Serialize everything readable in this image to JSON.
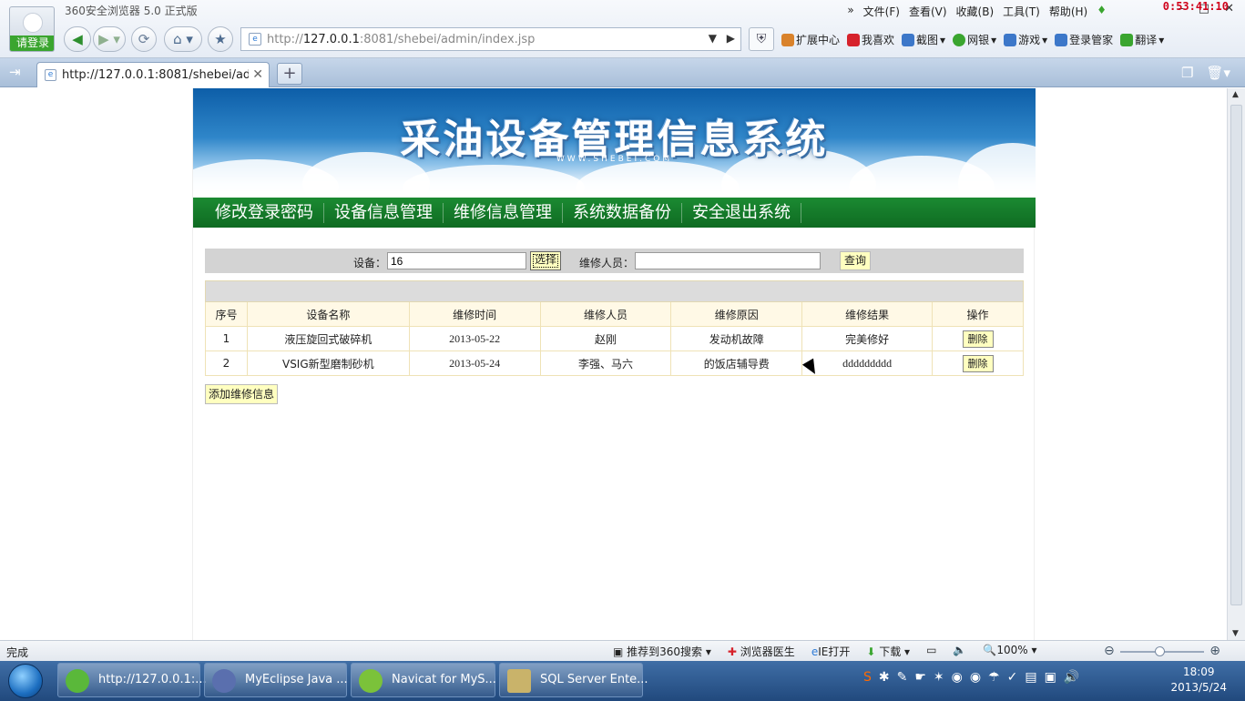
{
  "browser": {
    "title": "360安全浏览器 5.0 正式版",
    "login_label": "请登录",
    "menu": [
      "文件(F)",
      "查看(V)",
      "收藏(B)",
      "工具(T)",
      "帮助(H)"
    ],
    "timer": "0:53:41:10",
    "address": {
      "protocol": "http://",
      "host": "127.0.0.1",
      "path": ":8081/shebei/admin/index.jsp"
    },
    "toolbar_links": [
      {
        "label": "扩展中心",
        "icon": "extension-icon",
        "color": "#d9822b"
      },
      {
        "label": "我喜欢",
        "icon": "heart-icon",
        "color": "#d6222b"
      },
      {
        "label": "截图",
        "icon": "screenshot-icon",
        "color": "#3c77c9"
      },
      {
        "label": "网银",
        "icon": "bank-icon",
        "color": "#3aa52f"
      },
      {
        "label": "游戏",
        "icon": "game-icon",
        "color": "#3c77c9"
      },
      {
        "label": "登录管家",
        "icon": "key-icon",
        "color": "#3c77c9"
      },
      {
        "label": "翻译",
        "icon": "translate-icon",
        "color": "#3aa52f"
      }
    ],
    "tab": {
      "title": "http://127.0.0.1:8081/shebei/admi..."
    }
  },
  "site": {
    "title": "采油设备管理信息系统",
    "subtitle": "WWW.SHEBEI.COM",
    "nav": [
      "修改登录密码",
      "设备信息管理",
      "维修信息管理",
      "系统数据备份",
      "安全退出系统"
    ]
  },
  "search": {
    "device_label": "设备：",
    "device_value": "16",
    "select_label": "选择",
    "repair_person_label": "维修人员：",
    "repair_person_value": "",
    "query_label": "查询"
  },
  "table": {
    "columns": [
      "序号",
      "设备名称",
      "维修时间",
      "维修人员",
      "维修原因",
      "维修结果",
      "操作"
    ],
    "rows": [
      {
        "no": "1",
        "device": "液压旋回式破碎机",
        "time": "2013-05-22",
        "person": "赵刚",
        "reason": "发动机故障",
        "result": "完美修好",
        "action": "删除"
      },
      {
        "no": "2",
        "device": "VSIG新型磨制砂机",
        "time": "2013-05-24",
        "person": "李强、马六",
        "reason": "的饭店辅导费",
        "result": "ddddddddd",
        "action": "删除"
      }
    ]
  },
  "add_button": "添加维修信息",
  "status": {
    "text": "完成",
    "tools": [
      "推荐到360搜索",
      "浏览器医生",
      "IE打开",
      "下载",
      "100%"
    ]
  },
  "taskbar": {
    "items": [
      {
        "label": "http://127.0.0.1:...",
        "color": "#5ab83a"
      },
      {
        "label": "MyEclipse Java ...",
        "color": "#5a6fae"
      },
      {
        "label": "Navicat for MyS...",
        "color": "#7bc23a"
      },
      {
        "label": "SQL Server Ente...",
        "color": "#c9b36a"
      }
    ],
    "clock_time": "18:09",
    "clock_date": "2013/5/24"
  }
}
